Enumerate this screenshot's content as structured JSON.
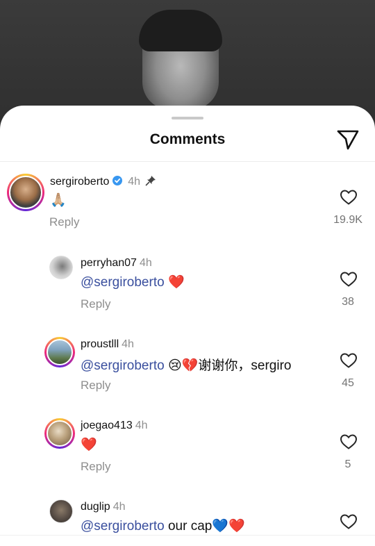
{
  "header": {
    "title": "Comments"
  },
  "comments": [
    {
      "user": "sergiroberto",
      "time": "4h",
      "verified": true,
      "pinned": true,
      "mention": "",
      "text": "🙏🏼",
      "reply": "Reply",
      "likes": "19.9K"
    },
    {
      "user": "perryhan07",
      "time": "4h",
      "mention": "@sergiroberto",
      "text": " ❤️",
      "reply": "Reply",
      "likes": "38"
    },
    {
      "user": "proustlll",
      "time": "4h",
      "mention": "@sergiroberto",
      "text": " 😢💔谢谢你，sergiro",
      "reply": "Reply",
      "likes": "45"
    },
    {
      "user": "joegao413",
      "time": "4h",
      "mention": "",
      "text": "❤️",
      "reply": "Reply",
      "likes": "5"
    },
    {
      "user": "duglip",
      "time": "4h",
      "mention": "@sergiroberto",
      "text": " our cap💙❤️",
      "reply": "",
      "likes": ""
    }
  ],
  "colors": {
    "mention": "#3a4f9e",
    "verified": "#3897f0"
  },
  "icons": {
    "send": "send-icon",
    "like": "heart-outline-icon",
    "pin": "pin-icon",
    "verified": "verified-badge-icon"
  }
}
